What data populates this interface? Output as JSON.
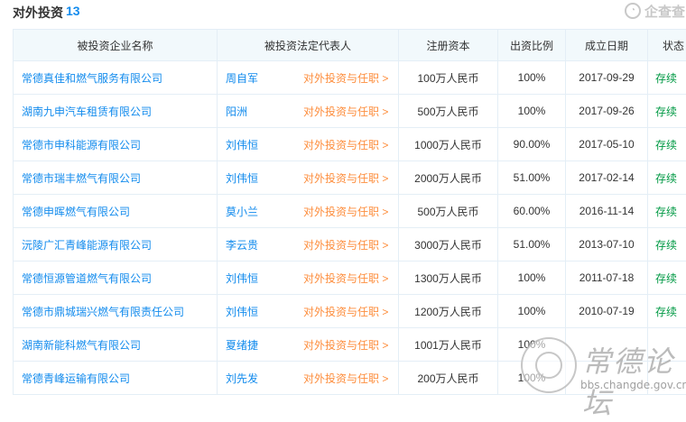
{
  "header": {
    "title": "对外投资",
    "count": "13",
    "brand_name": "企查查"
  },
  "table": {
    "columns": [
      "被投资企业名称",
      "被投资法定代表人",
      "注册资本",
      "出资比例",
      "成立日期",
      "状态"
    ],
    "rows": [
      {
        "company": "常德真佳和燃气服务有限公司",
        "rep": "周自军",
        "link": "对外投资与任职 >",
        "capital": "100万人民币",
        "ratio": "100%",
        "date": "2017-09-29",
        "status": "存续"
      },
      {
        "company": "湖南九申汽车租赁有限公司",
        "rep": "阳洲",
        "link": "对外投资与任职 >",
        "capital": "500万人民币",
        "ratio": "100%",
        "date": "2017-09-26",
        "status": "存续"
      },
      {
        "company": "常德市申科能源有限公司",
        "rep": "刘伟恒",
        "link": "对外投资与任职 >",
        "capital": "1000万人民币",
        "ratio": "90.00%",
        "date": "2017-05-10",
        "status": "存续"
      },
      {
        "company": "常德市瑞丰燃气有限公司",
        "rep": "刘伟恒",
        "link": "对外投资与任职 >",
        "capital": "2000万人民币",
        "ratio": "51.00%",
        "date": "2017-02-14",
        "status": "存续"
      },
      {
        "company": "常德申晖燃气有限公司",
        "rep": "莫小兰",
        "link": "对外投资与任职 >",
        "capital": "500万人民币",
        "ratio": "60.00%",
        "date": "2016-11-14",
        "status": "存续"
      },
      {
        "company": "沅陵广汇青峰能源有限公司",
        "rep": "李云贵",
        "link": "对外投资与任职 >",
        "capital": "3000万人民币",
        "ratio": "51.00%",
        "date": "2013-07-10",
        "status": "存续"
      },
      {
        "company": "常德恒源管道燃气有限公司",
        "rep": "刘伟恒",
        "link": "对外投资与任职 >",
        "capital": "1300万人民币",
        "ratio": "100%",
        "date": "2011-07-18",
        "status": "存续"
      },
      {
        "company": "常德市鼎城瑞兴燃气有限责任公司",
        "rep": "刘伟恒",
        "link": "对外投资与任职 >",
        "capital": "1200万人民币",
        "ratio": "100%",
        "date": "2010-07-19",
        "status": "存续"
      },
      {
        "company": "湖南新能科燃气有限公司",
        "rep": "夏绪捷",
        "link": "对外投资与任职 >",
        "capital": "1001万人民币",
        "ratio": "100%",
        "date": "",
        "status": ""
      },
      {
        "company": "常德青峰运输有限公司",
        "rep": "刘先发",
        "link": "对外投资与任职 >",
        "capital": "200万人民币",
        "ratio": "100%",
        "date": "",
        "status": ""
      }
    ]
  },
  "watermark": {
    "text": "常德论坛",
    "url": "bbs.changde.gov.cn"
  }
}
